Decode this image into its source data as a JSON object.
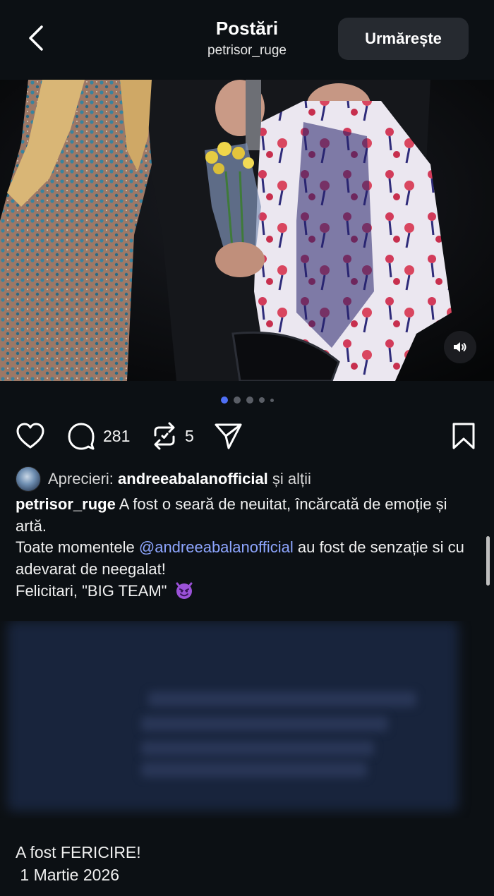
{
  "header": {
    "title": "Postări",
    "username": "petrisor_ruge",
    "follow_label": "Urmărește"
  },
  "media": {
    "carousel_total": 5,
    "carousel_active": 1
  },
  "actions": {
    "comments_count": "281",
    "reposts_count": "5"
  },
  "likes": {
    "prefix": "Aprecieri:",
    "user": "andreeabalanofficial",
    "suffix": "și alții"
  },
  "caption": {
    "author": "petrisor_ruge",
    "line1": "A fost o seară de neuitat, încărcată de emoție și artă.",
    "line2_before": "Toate momentele ",
    "mention": "@andreeabalanofficial",
    "line2_after": " au fost de senzație si cu adevarat de neegalat!",
    "line3": "Felicitari, \"BIG TEAM\""
  },
  "footer": {
    "line1": "A fost FERICIRE!",
    "line2": " 1 Martie 2026"
  },
  "colors": {
    "background": "#0c1014",
    "accent_dot": "#4f6ff5",
    "mention": "#8ea6ff",
    "follow_button": "#262a30"
  },
  "icons": [
    "back-arrow-icon",
    "speaker-icon",
    "heart-icon",
    "comment-icon",
    "repost-icon",
    "share-icon",
    "bookmark-icon",
    "devil-emoji-icon"
  ]
}
